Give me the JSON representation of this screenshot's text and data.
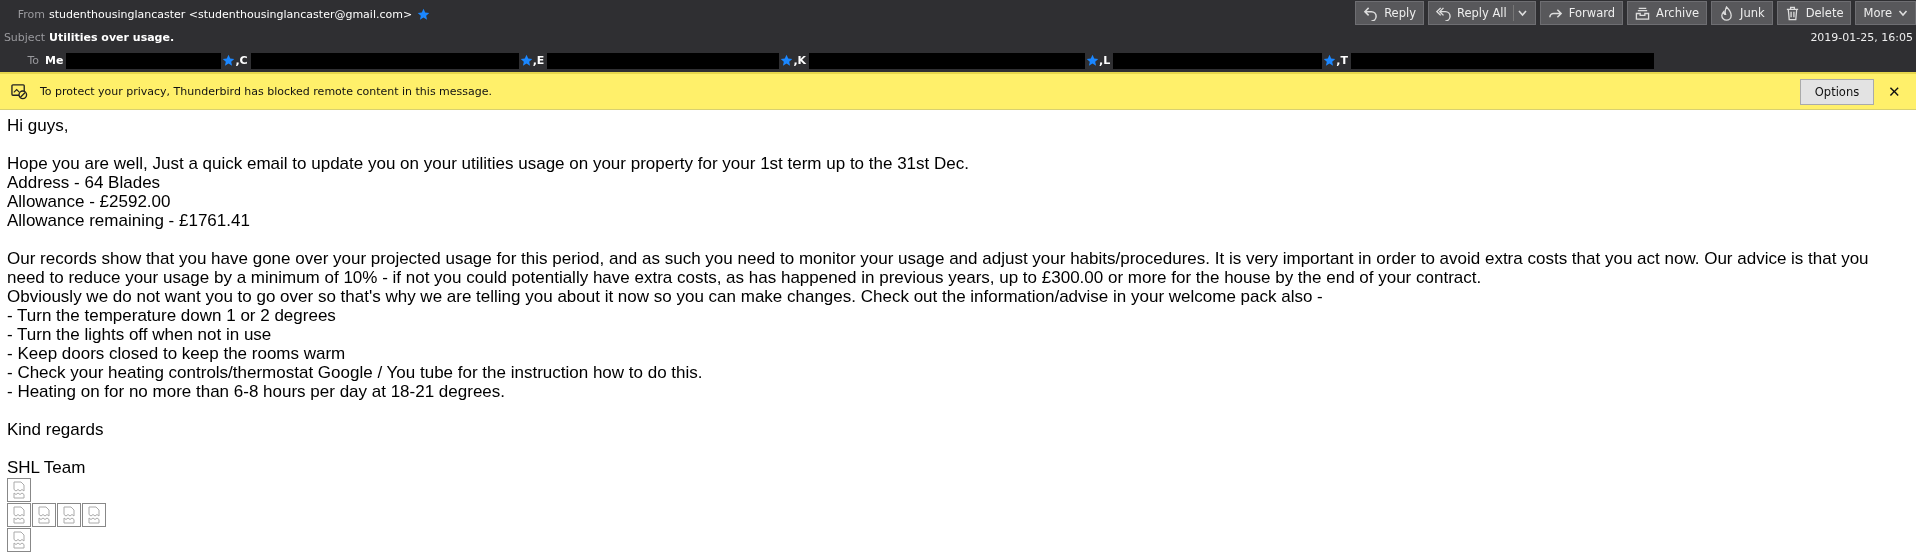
{
  "header": {
    "from_label": "From",
    "from": "studenthousinglancaster <studenthousinglancaster@gmail.com>",
    "from_starred": true,
    "subject_label": "Subject",
    "subject": "Utilities over usage.",
    "to_label": "To",
    "recipients": [
      {
        "name": "Me",
        "starred": false,
        "redacted": true
      },
      {
        "name": ",C",
        "starred": true,
        "redacted": true
      },
      {
        "name": ",E",
        "starred": true,
        "redacted": true
      },
      {
        "name": ",K",
        "starred": true,
        "redacted": true
      },
      {
        "name": ",L",
        "starred": true,
        "redacted": true
      },
      {
        "name": ",T",
        "starred": true,
        "redacted": true
      }
    ],
    "date": "2019-01-25, 16:05",
    "buttons": [
      {
        "kind": "reply",
        "label": "Reply",
        "dropdown": false
      },
      {
        "kind": "reply_all",
        "label": "Reply All",
        "dropdown": true
      },
      {
        "kind": "forward",
        "label": "Forward",
        "dropdown": false
      },
      {
        "kind": "archive",
        "label": "Archive",
        "dropdown": false
      },
      {
        "kind": "junk",
        "label": "Junk",
        "dropdown": false
      },
      {
        "kind": "delete",
        "label": "Delete",
        "dropdown": false
      },
      {
        "kind": "more",
        "label": "More",
        "dropdown": true
      }
    ]
  },
  "notice": {
    "text": "To protect your privacy, Thunderbird has blocked remote content in this message.",
    "button": "Options",
    "close": "✕"
  },
  "body": [
    {
      "lines": [
        "Hi guys,"
      ]
    },
    {
      "lines": [
        "Hope you are well, Just a quick email to update you on your utilities usage on your property for your 1st term up to the 31st Dec.",
        "Address - 64 Blades",
        "Allowance - £2592.00",
        "Allowance remaining - £1761.41"
      ]
    },
    {
      "lines": [
        "Our records show that you have gone over your projected usage for this period, and as such you need to monitor your usage and adjust your habits/procedures. It is very important in order to avoid extra costs that you act now. Our advice is that you need to reduce your usage by a minimum of 10% - if not you could potentially have extra costs, as has happened in previous years, up to £300.00 or more for the house by the end of your contract.",
        "Obviously we do not want you to go over so that's why we are telling you about it now so you can make changes. Check out the information/advise in your welcome pack also -",
        "- Turn the temperature down 1 or 2 degrees",
        "- Turn the lights off when not in use",
        "- Keep doors closed to keep the rooms warm",
        "- Check your heating controls/thermostat Google / You tube for the instruction how to do this.",
        "- Heating on for no more than 6-8 hours per day at 18-21 degrees."
      ]
    },
    {
      "lines": [
        "Kind regards"
      ]
    },
    {
      "lines": [
        "SHL Team"
      ]
    }
  ],
  "image_rows": [
    [
      {
        "kind": "broken_image"
      }
    ],
    [
      {
        "kind": "broken_image"
      },
      {
        "kind": "broken_image"
      },
      {
        "kind": "broken_image"
      },
      {
        "kind": "broken_image"
      }
    ],
    [
      {
        "kind": "broken_image"
      }
    ]
  ]
}
